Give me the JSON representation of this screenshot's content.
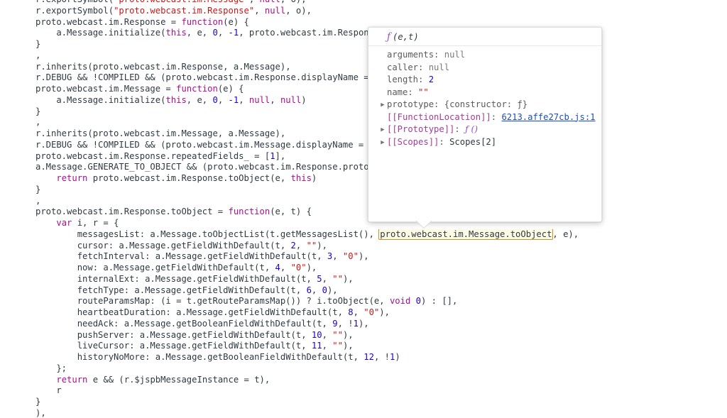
{
  "app": {
    "context": "devtools-sources-panel",
    "theme": "light"
  },
  "colors": {
    "string": "#c41a16",
    "keyword": "#aa0d91",
    "number": "#1c00cf",
    "plain": "#303942",
    "link": "#1a4fb4",
    "highlight_border": "#c9912f",
    "highlight_fill": "#fdfbe4",
    "function_glyph": "#9b4dca"
  },
  "code": {
    "language": "javascript",
    "highlighted_expression": "proto.webcast.im.Message.toObject",
    "lines": [
      [
        {
          "t": "r.exportSymbol(",
          "c": "plain"
        },
        {
          "t": "\"proto.webcast.im.Message\"",
          "c": "str"
        },
        {
          "t": ", ",
          "c": "plain"
        },
        {
          "t": "null",
          "c": "kw"
        },
        {
          "t": ", o),",
          "c": "plain"
        }
      ],
      [
        {
          "t": "r.exportSymbol(",
          "c": "plain"
        },
        {
          "t": "\"proto.webcast.im.Response\"",
          "c": "str"
        },
        {
          "t": ", ",
          "c": "plain"
        },
        {
          "t": "null",
          "c": "kw"
        },
        {
          "t": ", o),",
          "c": "plain"
        }
      ],
      [
        {
          "t": "proto.webcast.im.Response = ",
          "c": "plain"
        },
        {
          "t": "function",
          "c": "kw"
        },
        {
          "t": "(e) {",
          "c": "plain"
        }
      ],
      [
        {
          "t": "    a.Message.initialize(",
          "c": "plain"
        },
        {
          "t": "this",
          "c": "kw"
        },
        {
          "t": ", e, ",
          "c": "plain"
        },
        {
          "t": "0",
          "c": "num"
        },
        {
          "t": ", ",
          "c": "plain"
        },
        {
          "t": "-1",
          "c": "num"
        },
        {
          "t": ", proto.webcast.im.Response",
          "c": "plain"
        }
      ],
      [
        {
          "t": "}",
          "c": "plain"
        }
      ],
      [
        {
          "t": ",",
          "c": "plain"
        }
      ],
      [
        {
          "t": "r.inherits(proto.webcast.im.Response, a.Message),",
          "c": "plain"
        }
      ],
      [
        {
          "t": "r.DEBUG && !COMPILED && (proto.webcast.im.Response.displayName = ",
          "c": "plain"
        }
      ],
      [
        {
          "t": "proto.webcast.im.Message = ",
          "c": "plain"
        },
        {
          "t": "function",
          "c": "kw"
        },
        {
          "t": "(e) {",
          "c": "plain"
        }
      ],
      [
        {
          "t": "    a.Message.initialize(",
          "c": "plain"
        },
        {
          "t": "this",
          "c": "kw"
        },
        {
          "t": ", e, ",
          "c": "plain"
        },
        {
          "t": "0",
          "c": "num"
        },
        {
          "t": ", ",
          "c": "plain"
        },
        {
          "t": "-1",
          "c": "num"
        },
        {
          "t": ", ",
          "c": "plain"
        },
        {
          "t": "null",
          "c": "kw"
        },
        {
          "t": ", ",
          "c": "plain"
        },
        {
          "t": "null",
          "c": "kw"
        },
        {
          "t": ")",
          "c": "plain"
        }
      ],
      [
        {
          "t": "}",
          "c": "plain"
        }
      ],
      [
        {
          "t": ",",
          "c": "plain"
        }
      ],
      [
        {
          "t": "r.inherits(proto.webcast.im.Message, a.Message),",
          "c": "plain"
        }
      ],
      [
        {
          "t": "r.DEBUG && !COMPILED && (proto.webcast.im.Message.displayName = ",
          "c": "plain"
        },
        {
          "t": "\"",
          "c": "str"
        }
      ],
      [
        {
          "t": "proto.webcast.im.Response.repeatedFields_ = [",
          "c": "plain"
        },
        {
          "t": "1",
          "c": "num"
        },
        {
          "t": "],",
          "c": "plain"
        }
      ],
      [
        {
          "t": "a.Message.GENERATE_TO_OBJECT && (proto.webcast.im.Response.protot",
          "c": "plain"
        }
      ],
      [
        {
          "t": "    ",
          "c": "plain"
        },
        {
          "t": "return",
          "c": "kw"
        },
        {
          "t": " proto.webcast.im.Response.toObject(e, ",
          "c": "plain"
        },
        {
          "t": "this",
          "c": "kw"
        },
        {
          "t": ")",
          "c": "plain"
        }
      ],
      [
        {
          "t": "}",
          "c": "plain"
        }
      ],
      [
        {
          "t": ",",
          "c": "plain"
        }
      ],
      [
        {
          "t": "proto.webcast.im.Response.toObject = ",
          "c": "plain"
        },
        {
          "t": "function",
          "c": "kw"
        },
        {
          "t": "(e, t) {",
          "c": "plain"
        }
      ],
      [
        {
          "t": "    ",
          "c": "plain"
        },
        {
          "t": "var",
          "c": "kw"
        },
        {
          "t": " i, r = {",
          "c": "plain"
        }
      ],
      [
        {
          "t": "        messagesList: a.Message.toObjectList(t.getMessagesList(), ",
          "c": "plain"
        },
        {
          "t": "proto.webcast.im.Message.toObject",
          "c": "hl"
        },
        {
          "t": ", e),",
          "c": "plain"
        }
      ],
      [
        {
          "t": "        cursor: a.Message.getFieldWithDefault(t, ",
          "c": "plain"
        },
        {
          "t": "2",
          "c": "num"
        },
        {
          "t": ", ",
          "c": "plain"
        },
        {
          "t": "\"\"",
          "c": "str"
        },
        {
          "t": "),",
          "c": "plain"
        }
      ],
      [
        {
          "t": "        fetchInterval: a.Message.getFieldWithDefault(t, ",
          "c": "plain"
        },
        {
          "t": "3",
          "c": "num"
        },
        {
          "t": ", ",
          "c": "plain"
        },
        {
          "t": "\"0\"",
          "c": "str"
        },
        {
          "t": "),",
          "c": "plain"
        }
      ],
      [
        {
          "t": "        now: a.Message.getFieldWithDefault(t, ",
          "c": "plain"
        },
        {
          "t": "4",
          "c": "num"
        },
        {
          "t": ", ",
          "c": "plain"
        },
        {
          "t": "\"0\"",
          "c": "str"
        },
        {
          "t": "),",
          "c": "plain"
        }
      ],
      [
        {
          "t": "        internalExt: a.Message.getFieldWithDefault(t, ",
          "c": "plain"
        },
        {
          "t": "5",
          "c": "num"
        },
        {
          "t": ", ",
          "c": "plain"
        },
        {
          "t": "\"\"",
          "c": "str"
        },
        {
          "t": "),",
          "c": "plain"
        }
      ],
      [
        {
          "t": "        fetchType: a.Message.getFieldWithDefault(t, ",
          "c": "plain"
        },
        {
          "t": "6",
          "c": "num"
        },
        {
          "t": ", ",
          "c": "plain"
        },
        {
          "t": "0",
          "c": "num"
        },
        {
          "t": "),",
          "c": "plain"
        }
      ],
      [
        {
          "t": "        routeParamsMap: (i = t.getRouteParamsMap()) ? i.toObject(e, ",
          "c": "plain"
        },
        {
          "t": "void",
          "c": "kw"
        },
        {
          "t": " ",
          "c": "plain"
        },
        {
          "t": "0",
          "c": "num"
        },
        {
          "t": ") : [],",
          "c": "plain"
        }
      ],
      [
        {
          "t": "        heartbeatDuration: a.Message.getFieldWithDefault(t, ",
          "c": "plain"
        },
        {
          "t": "8",
          "c": "num"
        },
        {
          "t": ", ",
          "c": "plain"
        },
        {
          "t": "\"0\"",
          "c": "str"
        },
        {
          "t": "),",
          "c": "plain"
        }
      ],
      [
        {
          "t": "        needAck: a.Message.getBooleanFieldWithDefault(t, ",
          "c": "plain"
        },
        {
          "t": "9",
          "c": "num"
        },
        {
          "t": ", !",
          "c": "plain"
        },
        {
          "t": "1",
          "c": "num"
        },
        {
          "t": "),",
          "c": "plain"
        }
      ],
      [
        {
          "t": "        pushServer: a.Message.getFieldWithDefault(t, ",
          "c": "plain"
        },
        {
          "t": "10",
          "c": "num"
        },
        {
          "t": ", ",
          "c": "plain"
        },
        {
          "t": "\"\"",
          "c": "str"
        },
        {
          "t": "),",
          "c": "plain"
        }
      ],
      [
        {
          "t": "        liveCursor: a.Message.getFieldWithDefault(t, ",
          "c": "plain"
        },
        {
          "t": "11",
          "c": "num"
        },
        {
          "t": ", ",
          "c": "plain"
        },
        {
          "t": "\"\"",
          "c": "str"
        },
        {
          "t": "),",
          "c": "plain"
        }
      ],
      [
        {
          "t": "        historyNoMore: a.Message.getBooleanFieldWithDefault(t, ",
          "c": "plain"
        },
        {
          "t": "12",
          "c": "num"
        },
        {
          "t": ", !",
          "c": "plain"
        },
        {
          "t": "1",
          "c": "num"
        },
        {
          "t": ")",
          "c": "plain"
        }
      ],
      [
        {
          "t": "    };",
          "c": "plain"
        }
      ],
      [
        {
          "t": "    ",
          "c": "plain"
        },
        {
          "t": "return",
          "c": "kw"
        },
        {
          "t": " e && (r.$jspbMessageInstance = t),",
          "c": "plain"
        }
      ],
      [
        {
          "t": "    r",
          "c": "plain"
        }
      ],
      [
        {
          "t": "}",
          "c": "plain"
        }
      ],
      [
        {
          "t": "),",
          "c": "plain"
        }
      ]
    ]
  },
  "popover": {
    "header": {
      "glyph": "ƒ",
      "signature": "(e,t)"
    },
    "properties": [
      {
        "expandable": false,
        "name": "arguments",
        "sep": ": ",
        "value": "null",
        "value_kind": "null",
        "internal": false
      },
      {
        "expandable": false,
        "name": "caller",
        "sep": ": ",
        "value": "null",
        "value_kind": "null",
        "internal": false
      },
      {
        "expandable": false,
        "name": "length",
        "sep": ": ",
        "value": "2",
        "value_kind": "num",
        "internal": false
      },
      {
        "expandable": false,
        "name": "name",
        "sep": ": ",
        "value": "\"\"",
        "value_kind": "str",
        "internal": false
      },
      {
        "expandable": true,
        "name": "prototype",
        "sep": ": ",
        "value": "{constructor: ƒ}",
        "value_kind": "obj",
        "internal": false
      },
      {
        "expandable": false,
        "name": "[[FunctionLocation]]",
        "sep": ": ",
        "value": "6213.affe27cb.js:1",
        "value_kind": "link",
        "internal": true
      },
      {
        "expandable": true,
        "name": "[[Prototype]]",
        "sep": ": ",
        "value": "ƒ ()",
        "value_kind": "fn",
        "internal": true
      },
      {
        "expandable": true,
        "name": "[[Scopes]]",
        "sep": ": ",
        "value": "Scopes[2]",
        "value_kind": "plain",
        "internal": true
      }
    ]
  }
}
